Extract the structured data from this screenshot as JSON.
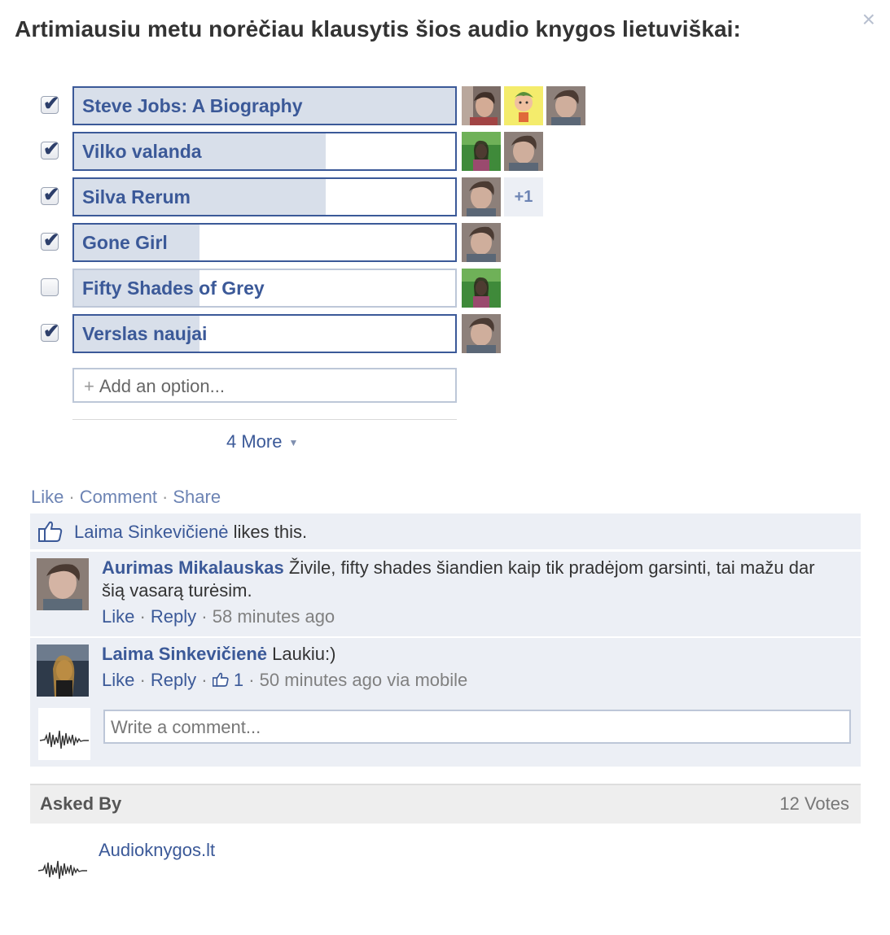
{
  "question": "Artimiausiu metu norėčiau klausytis šios audio knygos lietuviškai:",
  "close_glyph": "×",
  "options": [
    {
      "label": "Steve Jobs: A Biography",
      "checked": true,
      "share": 1.0,
      "voters": [
        "avatar-man-1",
        "avatar-cartoon",
        "avatar-man-2"
      ],
      "extra": ""
    },
    {
      "label": "Vilko valanda",
      "checked": true,
      "share": 0.66,
      "voters": [
        "avatar-woman-green",
        "avatar-man-2"
      ],
      "extra": ""
    },
    {
      "label": "Silva Rerum",
      "checked": true,
      "share": 0.66,
      "voters": [
        "avatar-man-2"
      ],
      "extra": "+1"
    },
    {
      "label": "Gone Girl",
      "checked": true,
      "share": 0.33,
      "voters": [
        "avatar-man-2"
      ],
      "extra": ""
    },
    {
      "label": "Fifty Shades of Grey",
      "checked": false,
      "share": 0.33,
      "voters": [
        "avatar-woman-green"
      ],
      "extra": ""
    },
    {
      "label": "Verslas naujai",
      "checked": true,
      "share": 0.33,
      "voters": [
        "avatar-man-2"
      ],
      "extra": ""
    }
  ],
  "add_option": {
    "plus": "+",
    "label": "Add an option..."
  },
  "more": {
    "label": "4 More",
    "caret": "▼"
  },
  "actions": {
    "like": "Like",
    "comment": "Comment",
    "share": "Share",
    "sep": "·"
  },
  "likes": {
    "name": "Laima Sinkevičienė",
    "text": " likes this."
  },
  "comments": [
    {
      "author": "Aurimas Mikalauskas",
      "text": "Živile, fifty shades šiandien kaip tik pradėjom garsinti, tai mažu dar šią vasarą turėsim.",
      "like": "Like",
      "reply": "Reply",
      "time": "58 minutes ago",
      "likes_count": ""
    },
    {
      "author": "Laima Sinkevičienė",
      "text": "Laukiu:)",
      "like": "Like",
      "reply": "Reply",
      "time": "50 minutes ago via mobile",
      "likes_count": "1"
    }
  ],
  "write_comment": {
    "placeholder": "Write a comment..."
  },
  "asked_by": {
    "label": "Asked By",
    "votes": "12 Votes",
    "page": "Audioknygos.lt"
  },
  "colors": {
    "link": "#3b5998",
    "fill": "#d8dfea",
    "panel": "#eceff5"
  }
}
